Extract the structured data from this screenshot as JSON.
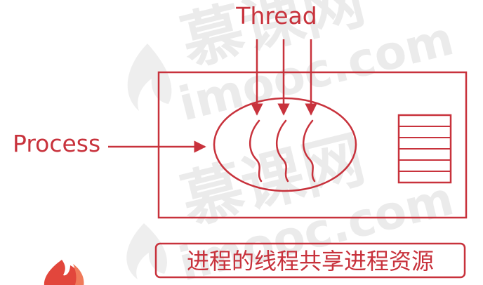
{
  "diagram": {
    "thread_label": "Thread",
    "process_label": "Process",
    "caption": "进程的线程共享进程资源",
    "accent_color": "#c8323c"
  },
  "watermark": {
    "brand_cn": "慕课网",
    "brand_en": "imooc.com",
    "logo_icon": "flame-logo-icon"
  }
}
